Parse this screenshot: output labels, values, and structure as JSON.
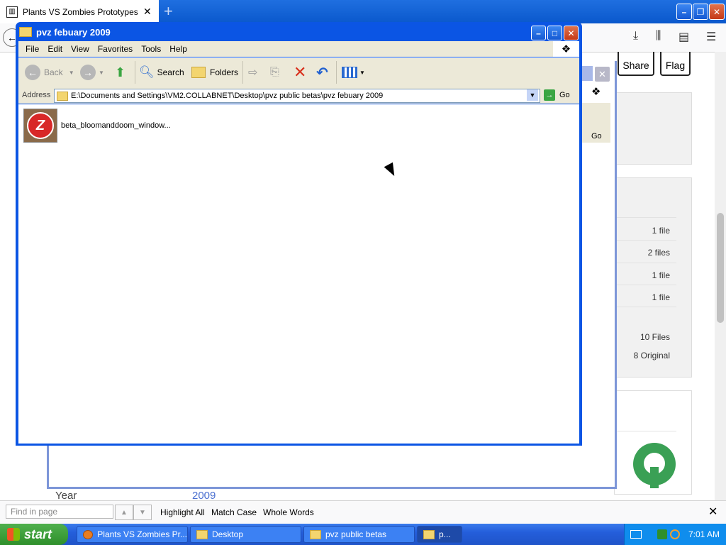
{
  "firefox": {
    "tab_title": "Plants VS Zombies Prototypes and",
    "new_tab": "+",
    "window_buttons": {
      "minimize": "–",
      "maximize": "❐",
      "close": "✕"
    }
  },
  "webpage": {
    "share_label": "Share",
    "flag_label": "Flag",
    "stats": [
      "1 file",
      "2 files",
      "1 file",
      "1 file",
      "10 Files",
      "8 Original"
    ],
    "year_label": "Year",
    "year_value": "2009"
  },
  "explorer": {
    "title": "pvz febuary 2009",
    "menu": [
      "File",
      "Edit",
      "View",
      "Favorites",
      "Tools",
      "Help"
    ],
    "toolbar": {
      "back": "Back",
      "search": "Search",
      "folders": "Folders"
    },
    "address_label": "Address",
    "address_path": "E:\\Documents and Settings\\VM2.COLLABNET\\Desktop\\pvz public betas\\pvz febuary 2009",
    "go_label": "Go",
    "files": [
      {
        "name": "beta_bloomanddoom_window..."
      }
    ]
  },
  "back_window": {
    "go_label": "Go"
  },
  "findbar": {
    "placeholder": "Find in page",
    "highlight_all": "Highlight All",
    "match_case": "Match Case",
    "whole_words": "Whole Words"
  },
  "taskbar": {
    "start_label": "start",
    "tasks": [
      "Plants VS Zombies Pr...",
      "Desktop",
      "pvz public betas",
      "p..."
    ],
    "clock": "7:01 AM"
  }
}
